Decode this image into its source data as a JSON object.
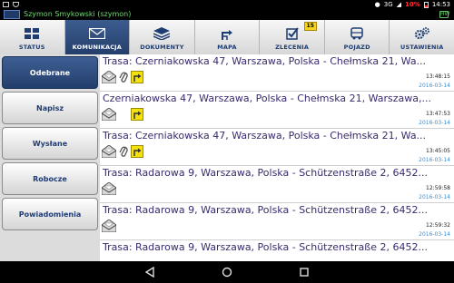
{
  "status_bar": {
    "network": "3G",
    "battery": "10%",
    "time": "14:53"
  },
  "app": {
    "user": "Szymon Smykowski (szymon)"
  },
  "tabs": [
    {
      "label": "STATUS",
      "icon": "grid-icon",
      "active": false
    },
    {
      "label": "KOMUNIKACJA",
      "icon": "envelope-icon",
      "active": true
    },
    {
      "label": "DOKUMENTY",
      "icon": "stack-icon",
      "active": false
    },
    {
      "label": "MAPA",
      "icon": "route-sign-icon",
      "active": false
    },
    {
      "label": "ZLECENIA",
      "icon": "checkbox-icon",
      "active": false,
      "badge": "15"
    },
    {
      "label": "POJAZD",
      "icon": "bus-icon",
      "active": false
    },
    {
      "label": "USTAWIENIA",
      "icon": "gears-icon",
      "active": false
    }
  ],
  "sidebar": {
    "items": [
      {
        "label": "Odebrane",
        "active": true
      },
      {
        "label": "Napisz",
        "active": false
      },
      {
        "label": "Wysłane",
        "active": false
      },
      {
        "label": "Robocze",
        "active": false
      },
      {
        "label": "Powiadomienia",
        "active": false
      }
    ]
  },
  "messages": [
    {
      "title": "Trasa: Czerniakowska 47, Warszawa, Polska - Chełmska 21, Wa...",
      "time": "13:48:15",
      "date": "2016-03-14",
      "icons": [
        "open-envelope-icon",
        "paperclip-icon",
        "route-icon"
      ]
    },
    {
      "title": "Czerniakowska 47, Warszawa, Polska - Chełmska 21, Warszawa,...",
      "time": "13:47:53",
      "date": "2016-03-14",
      "icons": [
        "open-envelope-icon",
        "route-icon"
      ]
    },
    {
      "title": "Trasa: Czerniakowska 47, Warszawa, Polska - Chełmska 21, Wa...",
      "time": "13:45:05",
      "date": "2016-03-14",
      "icons": [
        "open-envelope-icon",
        "paperclip-icon",
        "route-icon"
      ]
    },
    {
      "title": "Trasa: Radarowa 9, Warszawa, Polska - Schützenstraße 2, 6452...",
      "time": "12:59:58",
      "date": "2016-03-14",
      "icons": [
        "open-envelope-icon"
      ]
    },
    {
      "title": "Trasa: Radarowa 9, Warszawa, Polska - Schützenstraße 2, 6452...",
      "time": "12:59:32",
      "date": "2016-03-14",
      "icons": [
        "open-envelope-icon"
      ]
    },
    {
      "title": "Trasa: Radarowa 9, Warszawa, Polska - Schützenstraße 2, 6452...",
      "time": "",
      "date": "",
      "icons": []
    }
  ],
  "colors": {
    "active_tab": "#2b4a7e",
    "accent_yellow": "#f5e10a",
    "title_text": "#3a2a6e",
    "date_text": "#3a8fd8"
  }
}
